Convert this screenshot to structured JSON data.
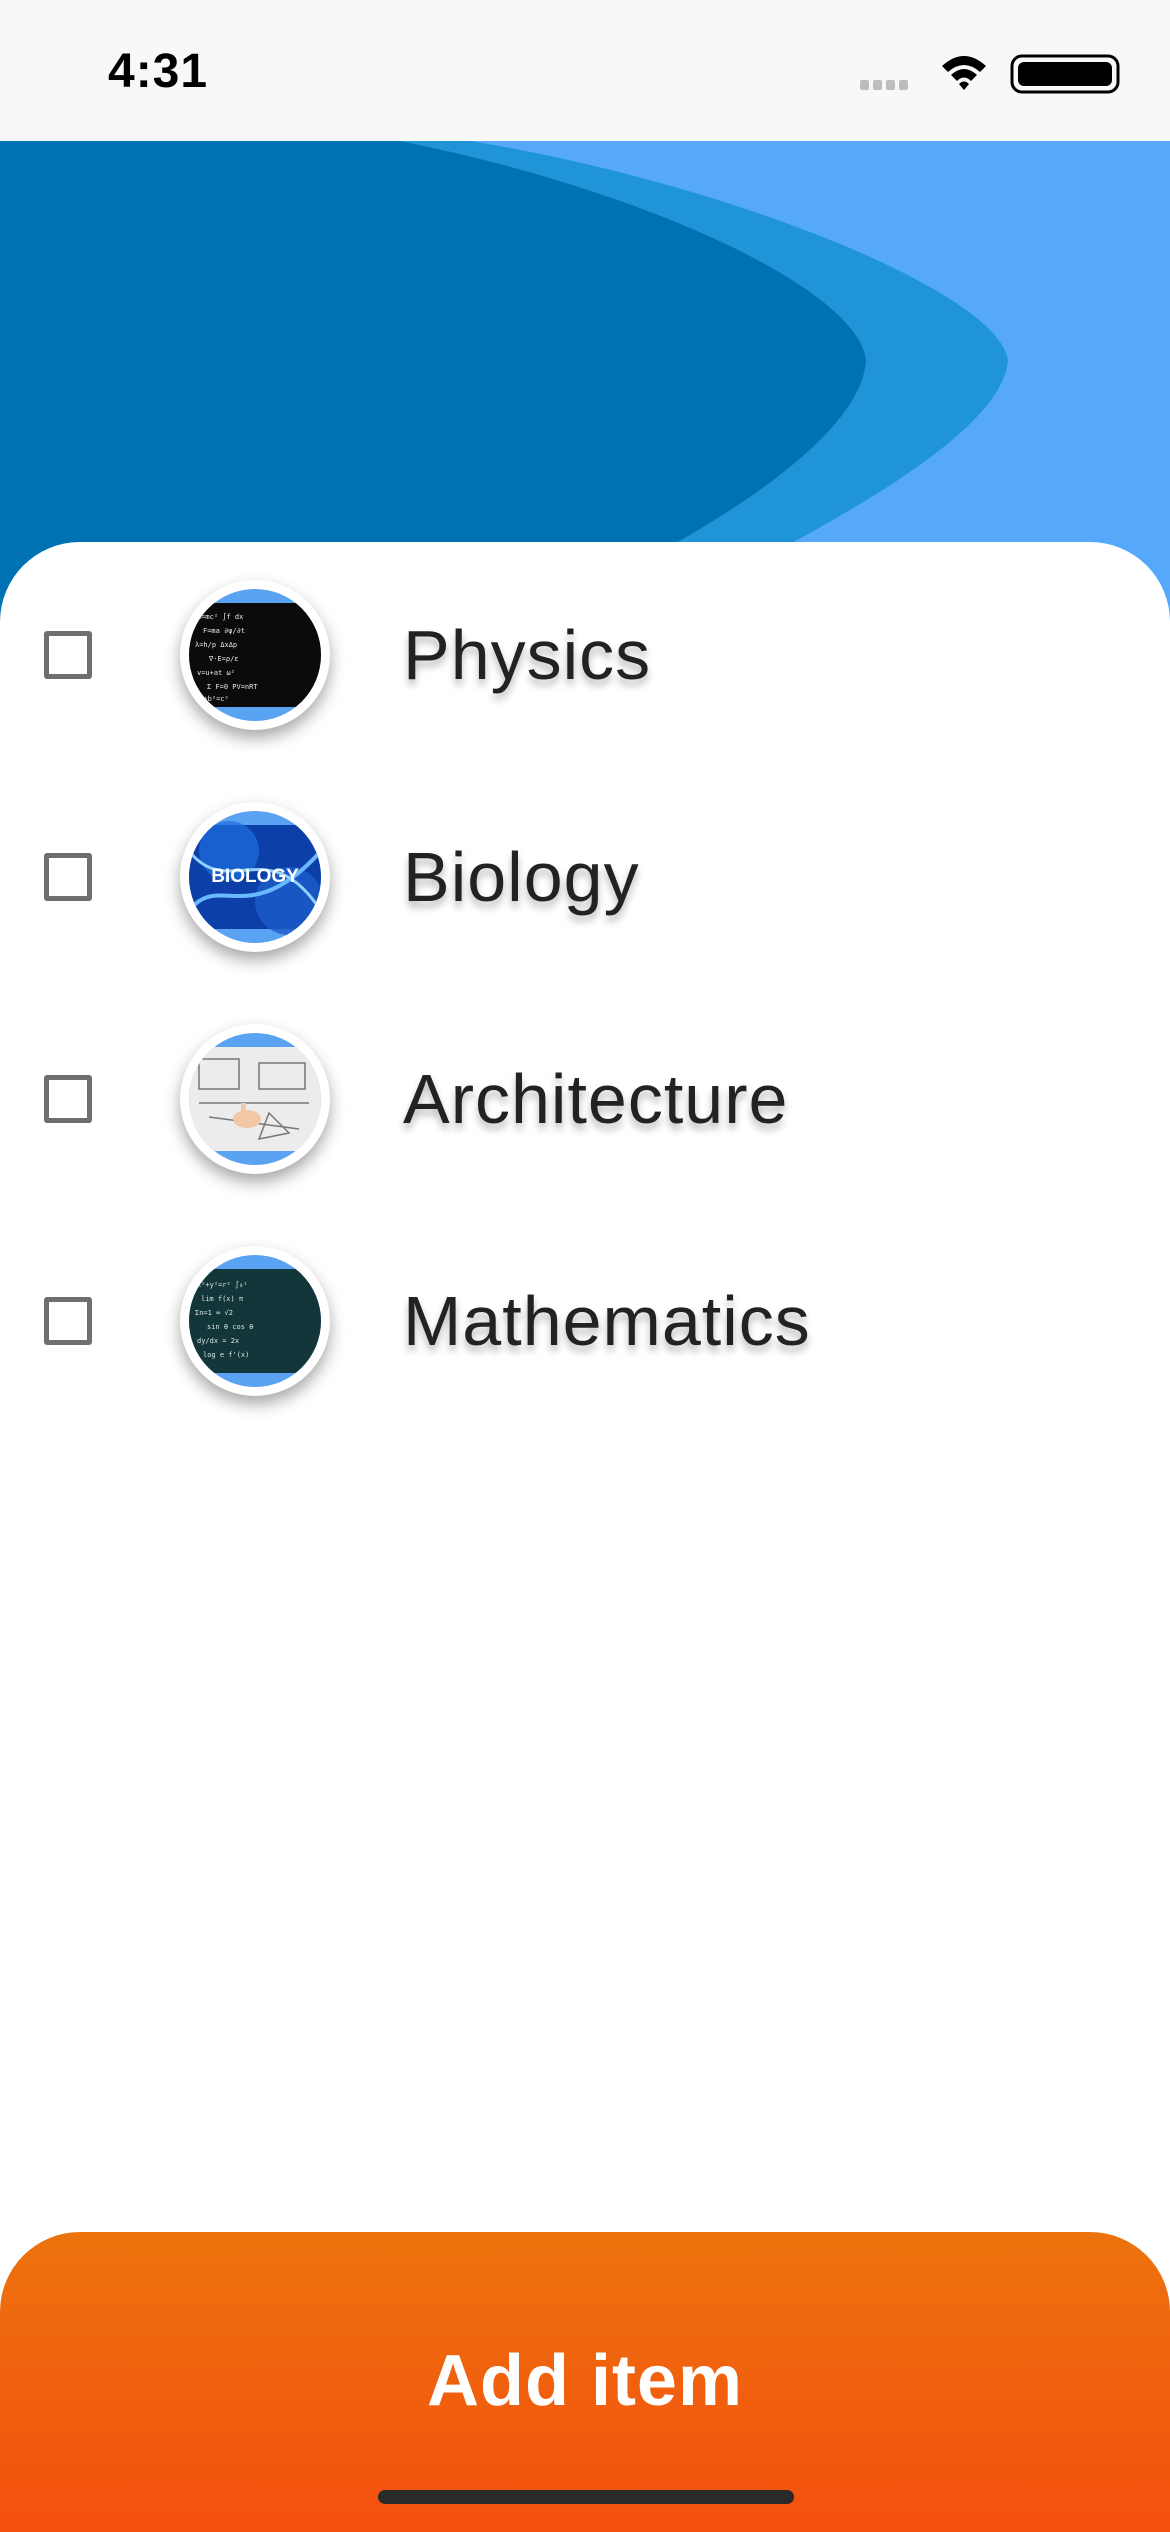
{
  "status_bar": {
    "time": "4:31",
    "icons": [
      "cellular-signal-icon",
      "wifi-icon",
      "battery-icon"
    ]
  },
  "header": {
    "colors": [
      "#0071b3",
      "#1f95d8",
      "#56a8fb"
    ]
  },
  "subjects": [
    {
      "label": "Physics",
      "checked": false,
      "image": "physics-formulas-image"
    },
    {
      "label": "Biology",
      "checked": false,
      "image": "biology-dna-image",
      "image_text": "BIOLOGY"
    },
    {
      "label": "Architecture",
      "checked": false,
      "image": "architecture-blueprint-image"
    },
    {
      "label": "Mathematics",
      "checked": false,
      "image": "mathematics-chalkboard-image"
    }
  ],
  "add_button": {
    "label": "Add item",
    "colors": [
      "#ec730d",
      "#f44f0f"
    ]
  }
}
